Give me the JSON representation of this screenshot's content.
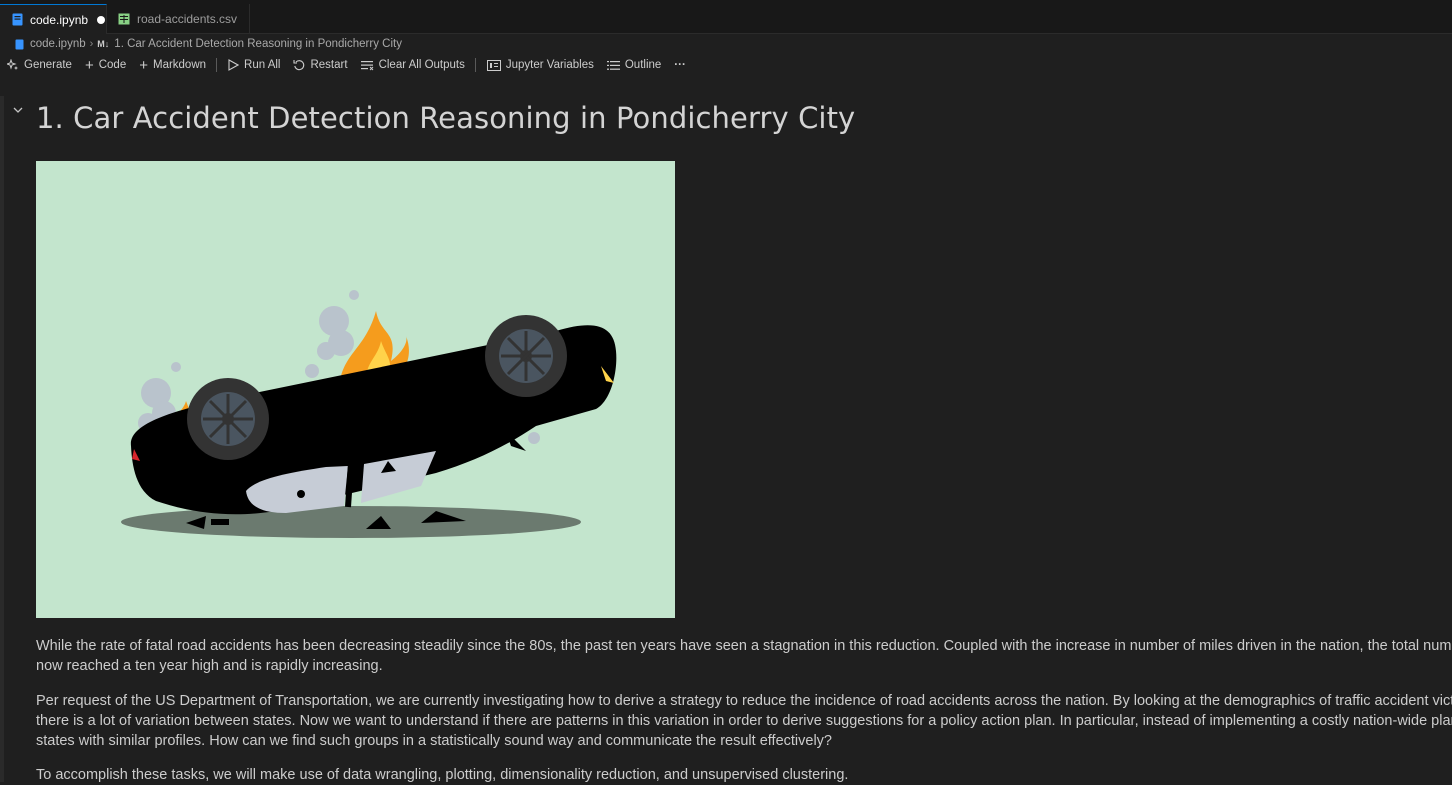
{
  "tabs": [
    {
      "label": "code.ipynb",
      "icon": "notebook-icon",
      "dirty": true,
      "active": true
    },
    {
      "label": "road-accidents.csv",
      "icon": "csv-icon",
      "active": false
    }
  ],
  "breadcrumb": {
    "file": "code.ipynb",
    "section_badge": "M↓",
    "section": "1. Car Accident Detection Reasoning in Pondicherry City"
  },
  "toolbar": {
    "generate": "Generate",
    "code": "Code",
    "markdown": "Markdown",
    "run_all": "Run All",
    "restart": "Restart",
    "clear_all_outputs": "Clear All Outputs",
    "jupyter_variables": "Jupyter Variables",
    "outline": "Outline",
    "more": "···"
  },
  "cell": {
    "heading": "1. Car Accident Detection Reasoning in Pondicherry City",
    "paragraphs": {
      "p1_l1": "While the rate of fatal road accidents has been decreasing steadily since the 80s, the past ten years have seen a stagnation in this reduction. Coupled with the increase in number of miles driven in the nation, the total number",
      "p1_l2": "now reached a ten year high and is rapidly increasing.",
      "p2_l1": "Per request of the US Department of Transportation, we are currently investigating how to derive a strategy to reduce the incidence of road accidents across the nation. By looking at the demographics of traffic accident victims",
      "p2_l2": "there is a lot of variation between states. Now we want to understand if there are patterns in this variation in order to derive suggestions for a policy action plan. In particular, instead of implementing a costly nation-wide plan",
      "p2_l3": "states with similar profiles. How can we find such groups in a statistically sound way and communicate the result effectively?",
      "p3_l1": "To accomplish these tasks, we will make use of data wrangling, plotting, dimensionality reduction, and unsupervised clustering."
    }
  },
  "colors": {
    "illustration_bg": "#c3e5cd",
    "car": "#000000",
    "fire": "#f59c1d",
    "smoke": "#b9c3cc"
  }
}
